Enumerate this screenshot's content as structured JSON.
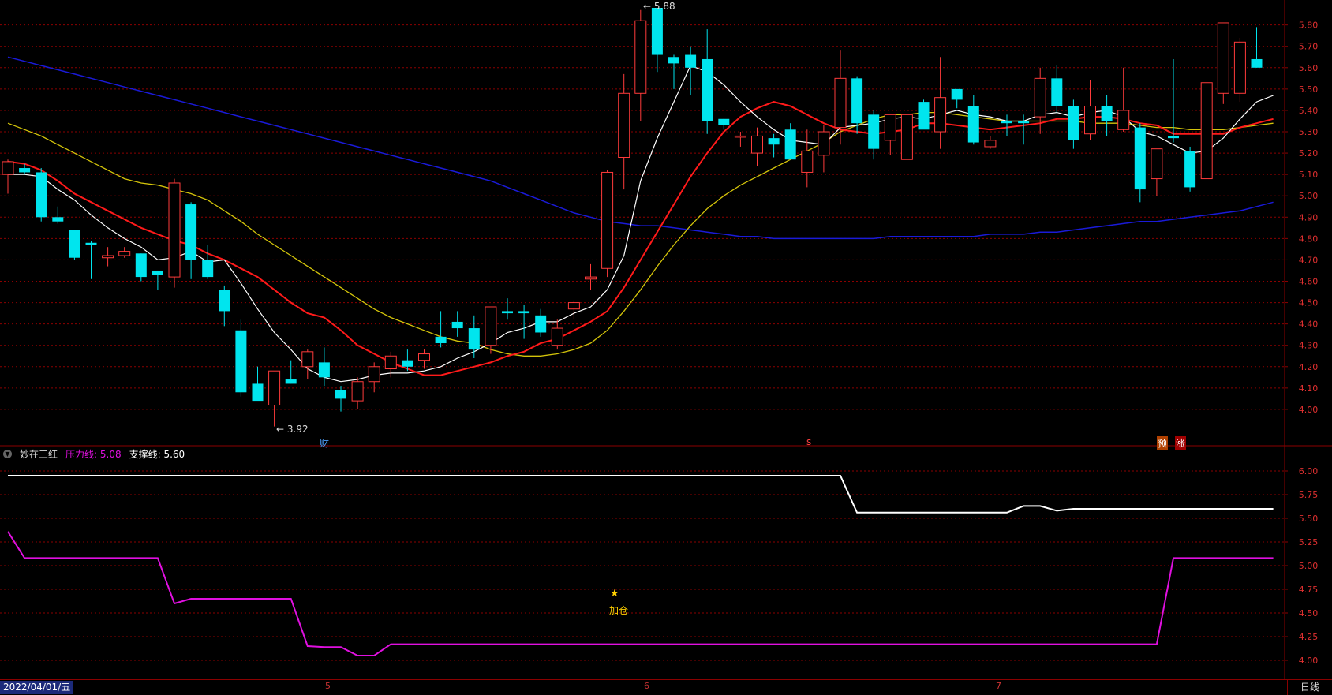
{
  "colors": {
    "up": "#ff3b3b",
    "down": "#00e5ee",
    "ma5": "#ffffff",
    "ma10": "#ff1a1a",
    "ma20": "#d4c40a",
    "ma60": "#1a1ad8",
    "resistance": "#e010e0",
    "support": "#ffffff",
    "grid": "#8b0000",
    "axis_text": "#e03030"
  },
  "header": {
    "indicator_name": "妙在三红",
    "resistance_label": "压力线: 5.08",
    "support_label": "支撑线: 5.60"
  },
  "markers": {
    "high_label": "5.88",
    "low_label": "3.92",
    "caibao": "财",
    "s_mark": "s",
    "yu": "预",
    "zhang": "涨",
    "star": "★",
    "add_position": "加仓"
  },
  "bottom": {
    "date": "2022/04/01/五",
    "period": "日线",
    "months": [
      "5",
      "6",
      "7"
    ]
  },
  "chart_data": {
    "type": "candlestick",
    "main_axis": {
      "ticks": [
        4.0,
        4.1,
        4.2,
        4.3,
        4.4,
        4.5,
        4.6,
        4.7,
        4.8,
        4.9,
        5.0,
        5.1,
        5.2,
        5.3,
        5.4,
        5.5,
        5.6,
        5.7,
        5.8
      ],
      "ylim": [
        3.9,
        5.88
      ]
    },
    "candles": [
      [
        5.1,
        5.17,
        5.01,
        5.16
      ],
      [
        5.13,
        5.15,
        5.1,
        5.11
      ],
      [
        5.11,
        5.13,
        4.88,
        4.9
      ],
      [
        4.9,
        4.95,
        4.87,
        4.88
      ],
      [
        4.84,
        4.84,
        4.7,
        4.71
      ],
      [
        4.78,
        4.79,
        4.61,
        4.77
      ],
      [
        4.71,
        4.76,
        4.67,
        4.72
      ],
      [
        4.72,
        4.76,
        4.71,
        4.74
      ],
      [
        4.73,
        4.73,
        4.6,
        4.62
      ],
      [
        4.65,
        4.65,
        4.56,
        4.63
      ],
      [
        4.62,
        5.08,
        4.57,
        5.06
      ],
      [
        4.96,
        4.97,
        4.61,
        4.7
      ],
      [
        4.7,
        4.77,
        4.61,
        4.62
      ],
      [
        4.56,
        4.58,
        4.39,
        4.46
      ],
      [
        4.37,
        4.42,
        4.06,
        4.08
      ],
      [
        4.12,
        4.2,
        4.05,
        4.04
      ],
      [
        4.02,
        4.18,
        3.92,
        4.18
      ],
      [
        4.14,
        4.23,
        4.12,
        4.12
      ],
      [
        4.2,
        4.28,
        4.14,
        4.27
      ],
      [
        4.22,
        4.29,
        4.11,
        4.15
      ],
      [
        4.09,
        4.11,
        3.99,
        4.05
      ],
      [
        4.04,
        4.15,
        4.0,
        4.13
      ],
      [
        4.13,
        4.22,
        4.08,
        4.2
      ],
      [
        4.19,
        4.27,
        4.15,
        4.25
      ],
      [
        4.23,
        4.28,
        4.18,
        4.2
      ],
      [
        4.23,
        4.28,
        4.19,
        4.26
      ],
      [
        4.34,
        4.46,
        4.29,
        4.31
      ],
      [
        4.41,
        4.46,
        4.34,
        4.38
      ],
      [
        4.38,
        4.44,
        4.24,
        4.28
      ],
      [
        4.3,
        4.48,
        4.26,
        4.48
      ],
      [
        4.46,
        4.52,
        4.42,
        4.45
      ],
      [
        4.46,
        4.49,
        4.33,
        4.45
      ],
      [
        4.44,
        4.47,
        4.34,
        4.36
      ],
      [
        4.3,
        4.42,
        4.28,
        4.38
      ],
      [
        4.47,
        4.51,
        4.42,
        4.5
      ],
      [
        4.61,
        4.68,
        4.56,
        4.62
      ],
      [
        4.66,
        5.12,
        4.62,
        5.11
      ],
      [
        5.18,
        5.57,
        5.03,
        5.48
      ],
      [
        5.48,
        5.87,
        5.35,
        5.82
      ],
      [
        5.88,
        5.87,
        5.58,
        5.66
      ],
      [
        5.65,
        5.66,
        5.5,
        5.62
      ],
      [
        5.66,
        5.7,
        5.47,
        5.6
      ],
      [
        5.64,
        5.78,
        5.29,
        5.35
      ],
      [
        5.36,
        5.36,
        5.31,
        5.33
      ],
      [
        5.28,
        5.3,
        5.23,
        5.28
      ],
      [
        5.2,
        5.32,
        5.14,
        5.28
      ],
      [
        5.27,
        5.29,
        5.18,
        5.24
      ],
      [
        5.31,
        5.34,
        5.19,
        5.17
      ],
      [
        5.11,
        5.31,
        5.04,
        5.21
      ],
      [
        5.19,
        5.33,
        5.11,
        5.3
      ],
      [
        5.32,
        5.68,
        5.24,
        5.55
      ],
      [
        5.55,
        5.56,
        5.29,
        5.34
      ],
      [
        5.38,
        5.4,
        5.17,
        5.22
      ],
      [
        5.26,
        5.33,
        5.19,
        5.38
      ],
      [
        5.17,
        5.37,
        5.17,
        5.38
      ],
      [
        5.44,
        5.45,
        5.36,
        5.31
      ],
      [
        5.3,
        5.65,
        5.22,
        5.46
      ],
      [
        5.5,
        5.49,
        5.41,
        5.45
      ],
      [
        5.42,
        5.47,
        5.24,
        5.25
      ],
      [
        5.23,
        5.28,
        5.22,
        5.26
      ],
      [
        5.35,
        5.38,
        5.28,
        5.34
      ],
      [
        5.35,
        5.38,
        5.24,
        5.34
      ],
      [
        5.37,
        5.6,
        5.29,
        5.55
      ],
      [
        5.55,
        5.61,
        5.39,
        5.42
      ],
      [
        5.42,
        5.45,
        5.22,
        5.26
      ],
      [
        5.29,
        5.54,
        5.26,
        5.42
      ],
      [
        5.42,
        5.47,
        5.28,
        5.35
      ],
      [
        5.31,
        5.6,
        5.3,
        5.4
      ],
      [
        5.32,
        5.34,
        4.97,
        5.03
      ],
      [
        5.08,
        5.21,
        5.0,
        5.22
      ],
      [
        5.28,
        5.64,
        5.25,
        5.27
      ],
      [
        5.21,
        5.23,
        5.02,
        5.04
      ],
      [
        5.08,
        5.53,
        5.08,
        5.53
      ],
      [
        5.48,
        5.81,
        5.43,
        5.81
      ],
      [
        5.48,
        5.74,
        5.44,
        5.72
      ],
      [
        5.64,
        5.79,
        5.6,
        5.6
      ]
    ],
    "ma5": [
      5.1,
      5.1,
      5.09,
      5.03,
      4.98,
      4.91,
      4.85,
      4.8,
      4.76,
      4.7,
      4.71,
      4.74,
      4.69,
      4.7,
      4.59,
      4.47,
      4.36,
      4.28,
      4.19,
      4.15,
      4.13,
      4.14,
      4.16,
      4.17,
      4.17,
      4.18,
      4.2,
      4.24,
      4.27,
      4.31,
      4.36,
      4.38,
      4.41,
      4.41,
      4.45,
      4.48,
      4.56,
      4.72,
      5.07,
      5.27,
      5.44,
      5.61,
      5.58,
      5.52,
      5.44,
      5.37,
      5.31,
      5.26,
      5.25,
      5.24,
      5.32,
      5.33,
      5.34,
      5.36,
      5.37,
      5.36,
      5.38,
      5.4,
      5.38,
      5.37,
      5.35,
      5.35,
      5.38,
      5.39,
      5.37,
      5.39,
      5.4,
      5.37,
      5.3,
      5.28,
      5.24,
      5.2,
      5.21,
      5.27,
      5.36,
      5.44,
      5.47
    ],
    "ma10": [
      5.16,
      5.15,
      5.12,
      5.07,
      5.01,
      4.97,
      4.93,
      4.89,
      4.85,
      4.82,
      4.79,
      4.77,
      4.73,
      4.7,
      4.66,
      4.62,
      4.56,
      4.5,
      4.45,
      4.43,
      4.37,
      4.3,
      4.26,
      4.22,
      4.19,
      4.16,
      4.16,
      4.18,
      4.2,
      4.22,
      4.25,
      4.27,
      4.31,
      4.33,
      4.37,
      4.41,
      4.46,
      4.57,
      4.7,
      4.83,
      4.96,
      5.09,
      5.2,
      5.3,
      5.37,
      5.41,
      5.44,
      5.42,
      5.38,
      5.34,
      5.31,
      5.3,
      5.29,
      5.3,
      5.31,
      5.34,
      5.34,
      5.33,
      5.32,
      5.31,
      5.32,
      5.33,
      5.34,
      5.36,
      5.36,
      5.37,
      5.37,
      5.36,
      5.34,
      5.33,
      5.29,
      5.29,
      5.29,
      5.29,
      5.32,
      5.34,
      5.36
    ],
    "ma20": [
      5.34,
      5.31,
      5.28,
      5.24,
      5.2,
      5.16,
      5.12,
      5.08,
      5.06,
      5.05,
      5.03,
      5.01,
      4.98,
      4.93,
      4.88,
      4.82,
      4.77,
      4.72,
      4.67,
      4.62,
      4.57,
      4.52,
      4.47,
      4.43,
      4.4,
      4.37,
      4.34,
      4.32,
      4.31,
      4.28,
      4.26,
      4.25,
      4.25,
      4.26,
      4.28,
      4.31,
      4.37,
      4.46,
      4.56,
      4.67,
      4.77,
      4.86,
      4.94,
      5.0,
      5.05,
      5.09,
      5.13,
      5.17,
      5.21,
      5.25,
      5.3,
      5.33,
      5.36,
      5.38,
      5.38,
      5.39,
      5.39,
      5.38,
      5.37,
      5.36,
      5.35,
      5.35,
      5.35,
      5.35,
      5.35,
      5.34,
      5.34,
      5.34,
      5.33,
      5.32,
      5.32,
      5.31,
      5.31,
      5.31,
      5.32,
      5.33,
      5.34
    ],
    "ma60": [
      5.65,
      5.63,
      5.61,
      5.59,
      5.57,
      5.55,
      5.53,
      5.51,
      5.49,
      5.47,
      5.45,
      5.43,
      5.41,
      5.39,
      5.37,
      5.35,
      5.33,
      5.31,
      5.29,
      5.27,
      5.25,
      5.23,
      5.21,
      5.19,
      5.17,
      5.15,
      5.13,
      5.11,
      5.09,
      5.07,
      5.04,
      5.01,
      4.98,
      4.95,
      4.92,
      4.9,
      4.88,
      4.87,
      4.86,
      4.86,
      4.85,
      4.84,
      4.83,
      4.82,
      4.81,
      4.81,
      4.8,
      4.8,
      4.8,
      4.8,
      4.8,
      4.8,
      4.8,
      4.81,
      4.81,
      4.81,
      4.81,
      4.81,
      4.81,
      4.82,
      4.82,
      4.82,
      4.83,
      4.83,
      4.84,
      4.85,
      4.86,
      4.87,
      4.88,
      4.88,
      4.89,
      4.9,
      4.91,
      4.92,
      4.93,
      4.95,
      4.97
    ],
    "sub_axis": {
      "ticks": [
        4.0,
        4.25,
        4.5,
        4.75,
        5.0,
        5.25,
        5.5,
        5.75,
        6.0
      ],
      "ylim": [
        3.85,
        6.1
      ]
    },
    "resistance": [
      5.36,
      5.08,
      5.08,
      5.08,
      5.08,
      5.08,
      5.08,
      5.08,
      5.08,
      5.08,
      4.6,
      4.65,
      4.65,
      4.65,
      4.65,
      4.65,
      4.65,
      4.65,
      4.15,
      4.14,
      4.14,
      4.05,
      4.05,
      4.17,
      4.17,
      4.17,
      4.17,
      4.17,
      4.17,
      4.17,
      4.17,
      4.17,
      4.17,
      4.17,
      4.17,
      4.17,
      4.17,
      4.17,
      4.17,
      4.17,
      4.17,
      4.17,
      4.17,
      4.17,
      4.17,
      4.17,
      4.17,
      4.17,
      4.17,
      4.17,
      4.17,
      4.17,
      4.17,
      4.17,
      4.17,
      4.17,
      4.17,
      4.17,
      4.17,
      4.17,
      4.17,
      4.17,
      4.17,
      4.17,
      4.17,
      4.17,
      4.17,
      4.17,
      4.17,
      4.17,
      5.08,
      5.08,
      5.08,
      5.08,
      5.08,
      5.08,
      5.08
    ],
    "support": [
      5.95,
      5.95,
      5.95,
      5.95,
      5.95,
      5.95,
      5.95,
      5.95,
      5.95,
      5.95,
      5.95,
      5.95,
      5.95,
      5.95,
      5.95,
      5.95,
      5.95,
      5.95,
      5.95,
      5.95,
      5.95,
      5.95,
      5.95,
      5.95,
      5.95,
      5.95,
      5.95,
      5.95,
      5.95,
      5.95,
      5.95,
      5.95,
      5.95,
      5.95,
      5.95,
      5.95,
      5.95,
      5.95,
      5.95,
      5.95,
      5.95,
      5.95,
      5.95,
      5.95,
      5.95,
      5.95,
      5.95,
      5.95,
      5.95,
      5.95,
      5.95,
      5.56,
      5.56,
      5.56,
      5.56,
      5.56,
      5.56,
      5.56,
      5.56,
      5.56,
      5.56,
      5.63,
      5.63,
      5.58,
      5.6,
      5.6,
      5.6,
      5.6,
      5.6,
      5.6,
      5.6,
      5.6,
      5.6,
      5.6,
      5.6,
      5.6,
      5.6
    ]
  }
}
